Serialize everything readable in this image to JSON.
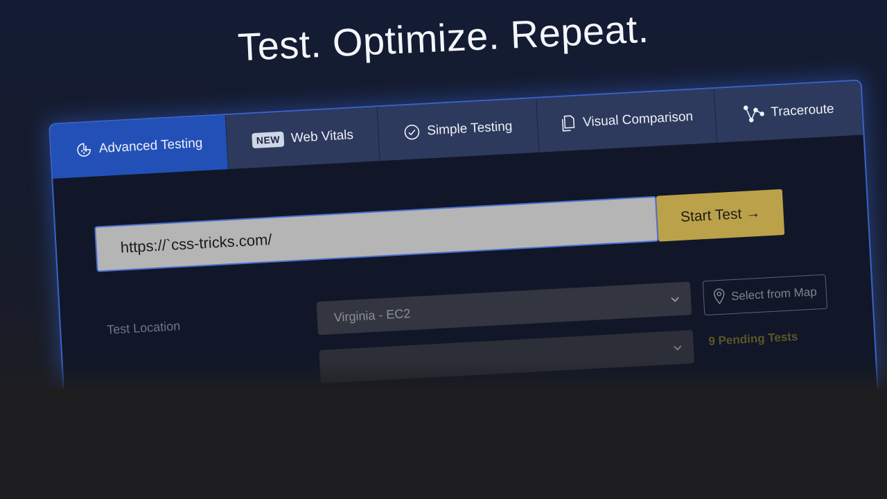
{
  "hero": {
    "headline": "Test. Optimize. Repeat."
  },
  "tabs": [
    {
      "label": "Advanced Testing",
      "icon": "advanced-testing-icon",
      "active": true
    },
    {
      "label": "Web Vitals",
      "badge": "NEW"
    },
    {
      "label": "Simple Testing",
      "icon": "check-circle-icon"
    },
    {
      "label": "Visual Comparison",
      "icon": "documents-icon"
    },
    {
      "label": "Traceroute",
      "icon": "traceroute-icon"
    }
  ],
  "url_field": {
    "value": "https://`css-tricks.com/"
  },
  "start_button": {
    "label": "Start Test →"
  },
  "location": {
    "label": "Test Location",
    "selected": "Virginia - EC2",
    "map_button": "Select from Map"
  },
  "pending": {
    "label": "9 Pending Tests"
  },
  "colors": {
    "active_tab": "#2350b7",
    "tab_bar": "#2d3a5d",
    "start_button": "#bba14a",
    "panel_border": "#3a63c9"
  }
}
